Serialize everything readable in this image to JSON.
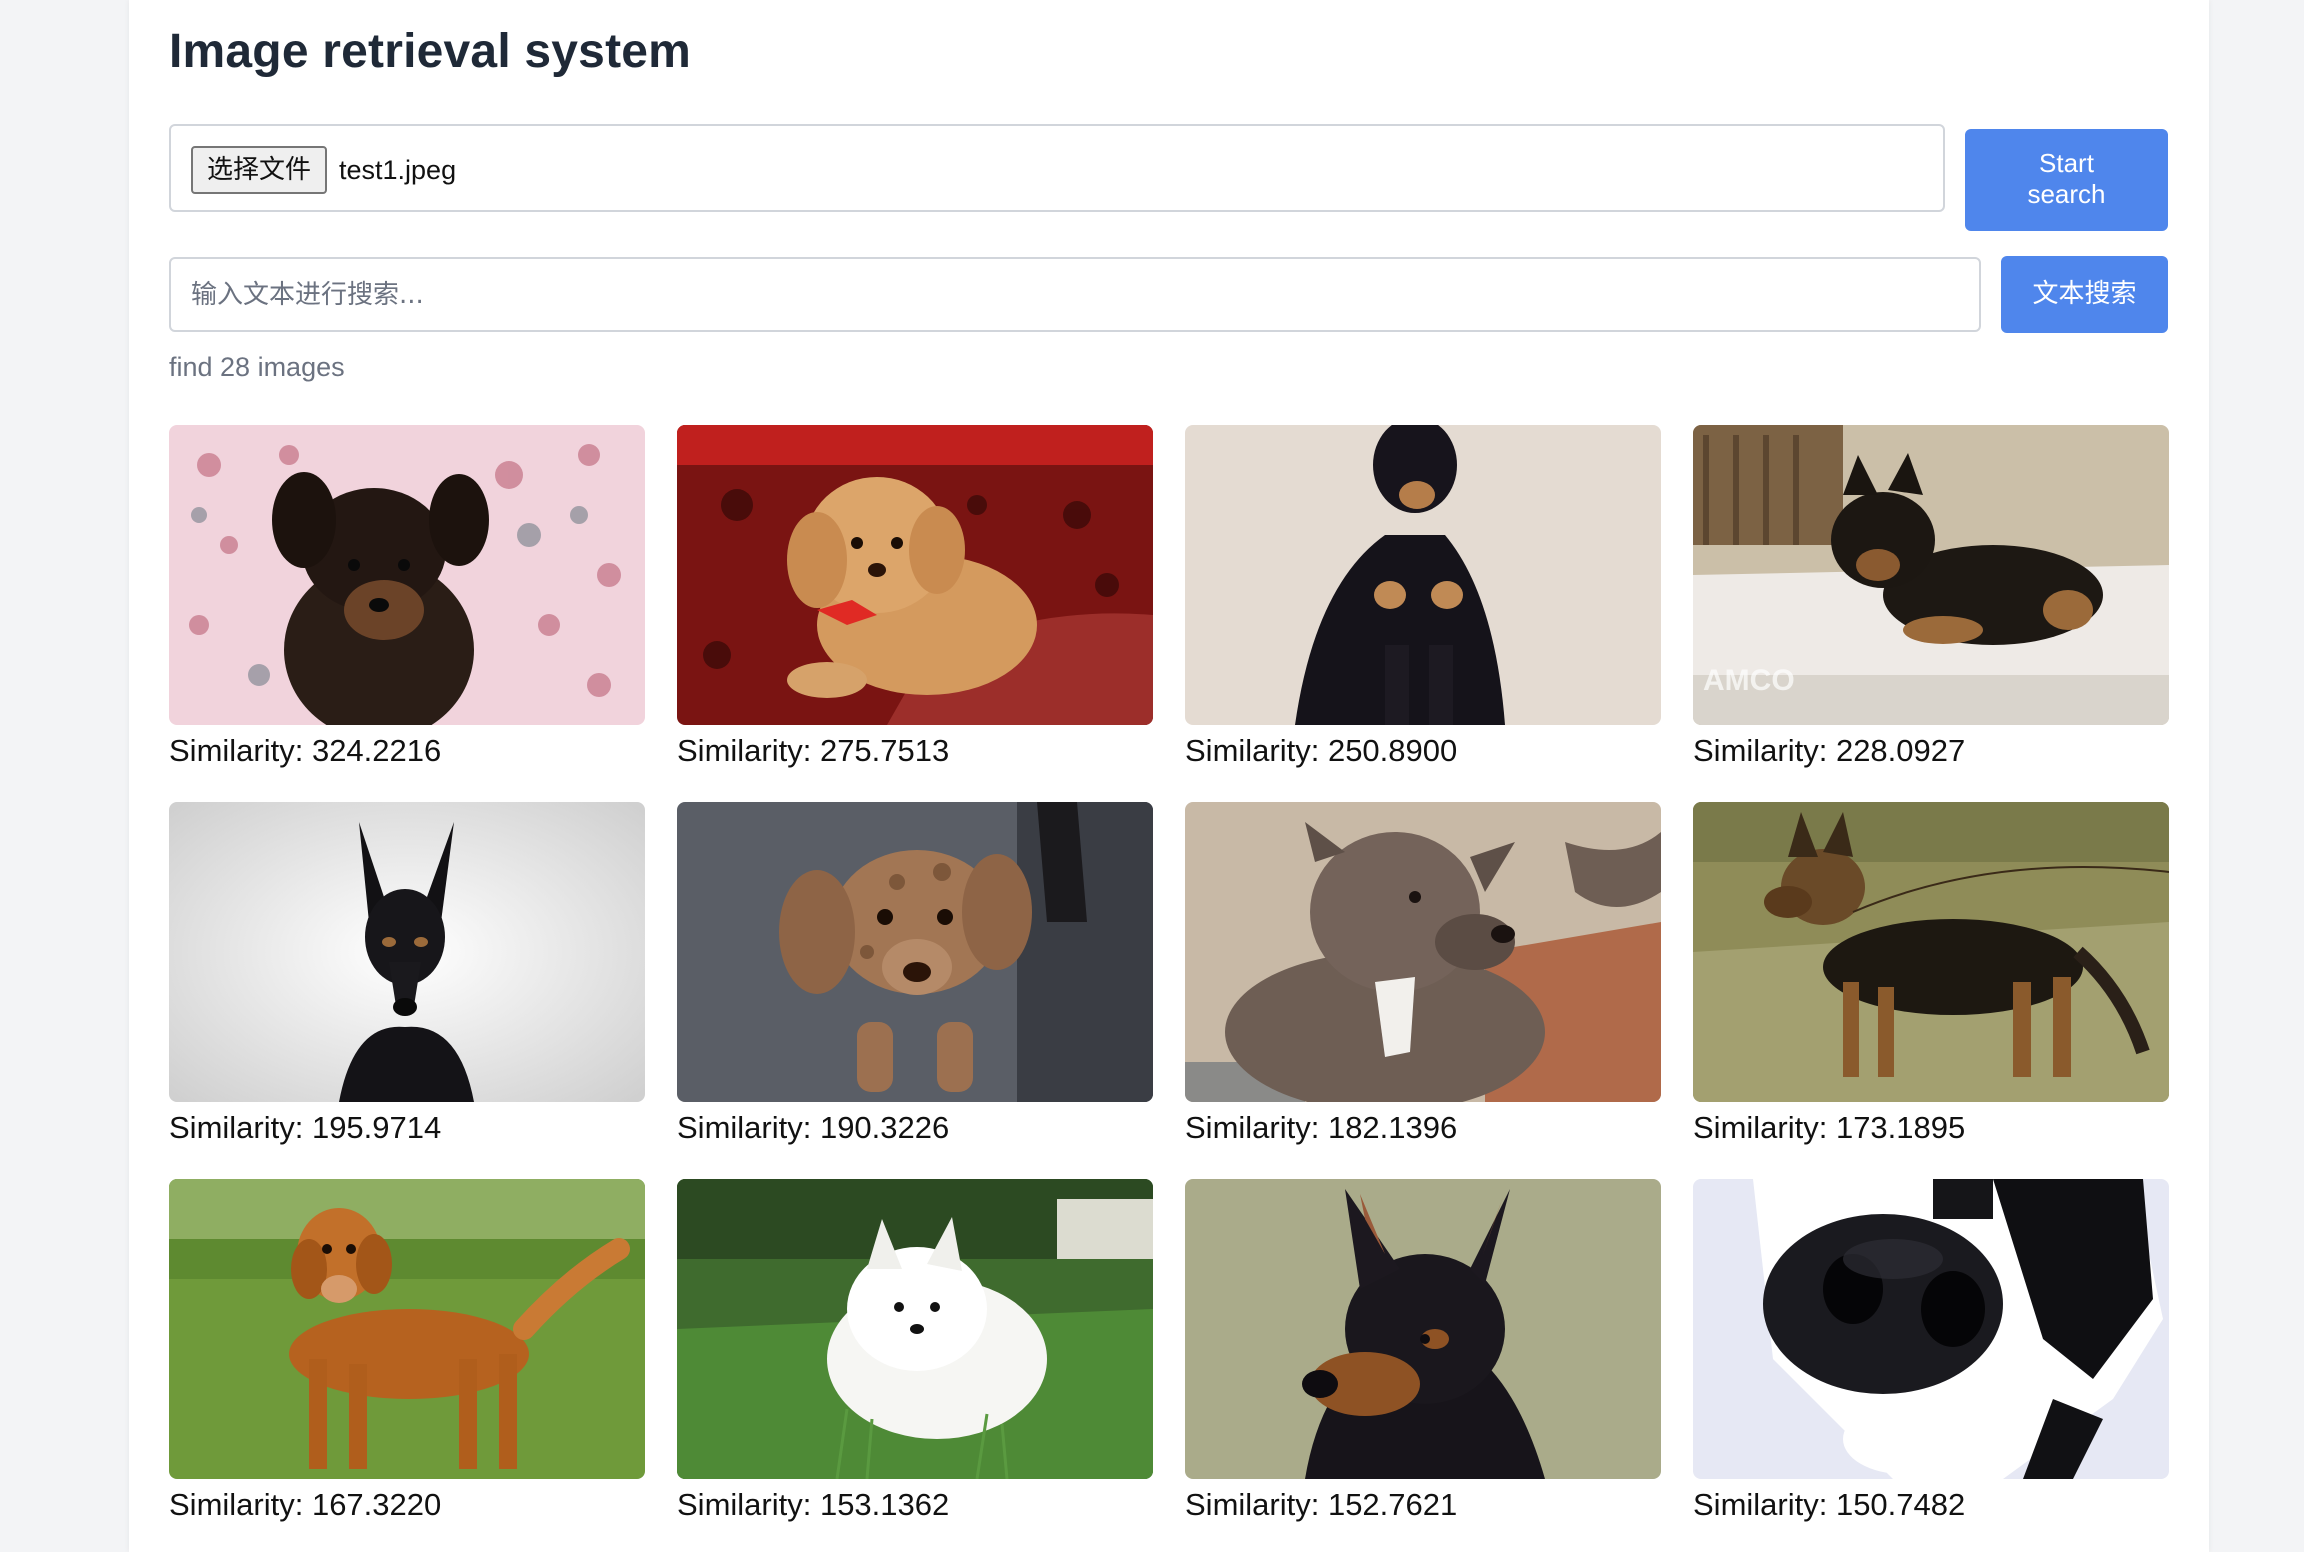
{
  "title": "Image retrieval system",
  "upload": {
    "choose_label": "选择文件",
    "file_name": "test1.jpeg",
    "start_label": "Start search"
  },
  "text_search": {
    "placeholder": "输入文本进行搜索...",
    "value": "",
    "button_label": "文本搜索"
  },
  "result_count": "find 28 images",
  "colors": {
    "accent": "#4f86ec",
    "page_bg": "#f3f4f6"
  },
  "results": [
    {
      "subject": "yorkshire-terrier-puppy",
      "similarity": "Similarity: 324.2216"
    },
    {
      "subject": "toy-poodle",
      "similarity": "Similarity: 275.7513"
    },
    {
      "subject": "doberman",
      "similarity": "Similarity: 250.8900"
    },
    {
      "subject": "german-shepherd-puppy",
      "similarity": "Similarity: 228.0927"
    },
    {
      "subject": "doberman-portrait",
      "similarity": "Similarity: 195.9714"
    },
    {
      "subject": "dapple-dachshund",
      "similarity": "Similarity: 190.3226"
    },
    {
      "subject": "pit-bull",
      "similarity": "Similarity: 182.1396"
    },
    {
      "subject": "german-shepherd",
      "similarity": "Similarity: 173.1895"
    },
    {
      "subject": "golden-retriever",
      "similarity": "Similarity: 167.3220"
    },
    {
      "subject": "white-spitz",
      "similarity": "Similarity: 153.1362"
    },
    {
      "subject": "miniature-pinscher",
      "similarity": "Similarity: 152.7621"
    },
    {
      "subject": "cow-nose",
      "similarity": "Similarity: 150.7482"
    }
  ]
}
